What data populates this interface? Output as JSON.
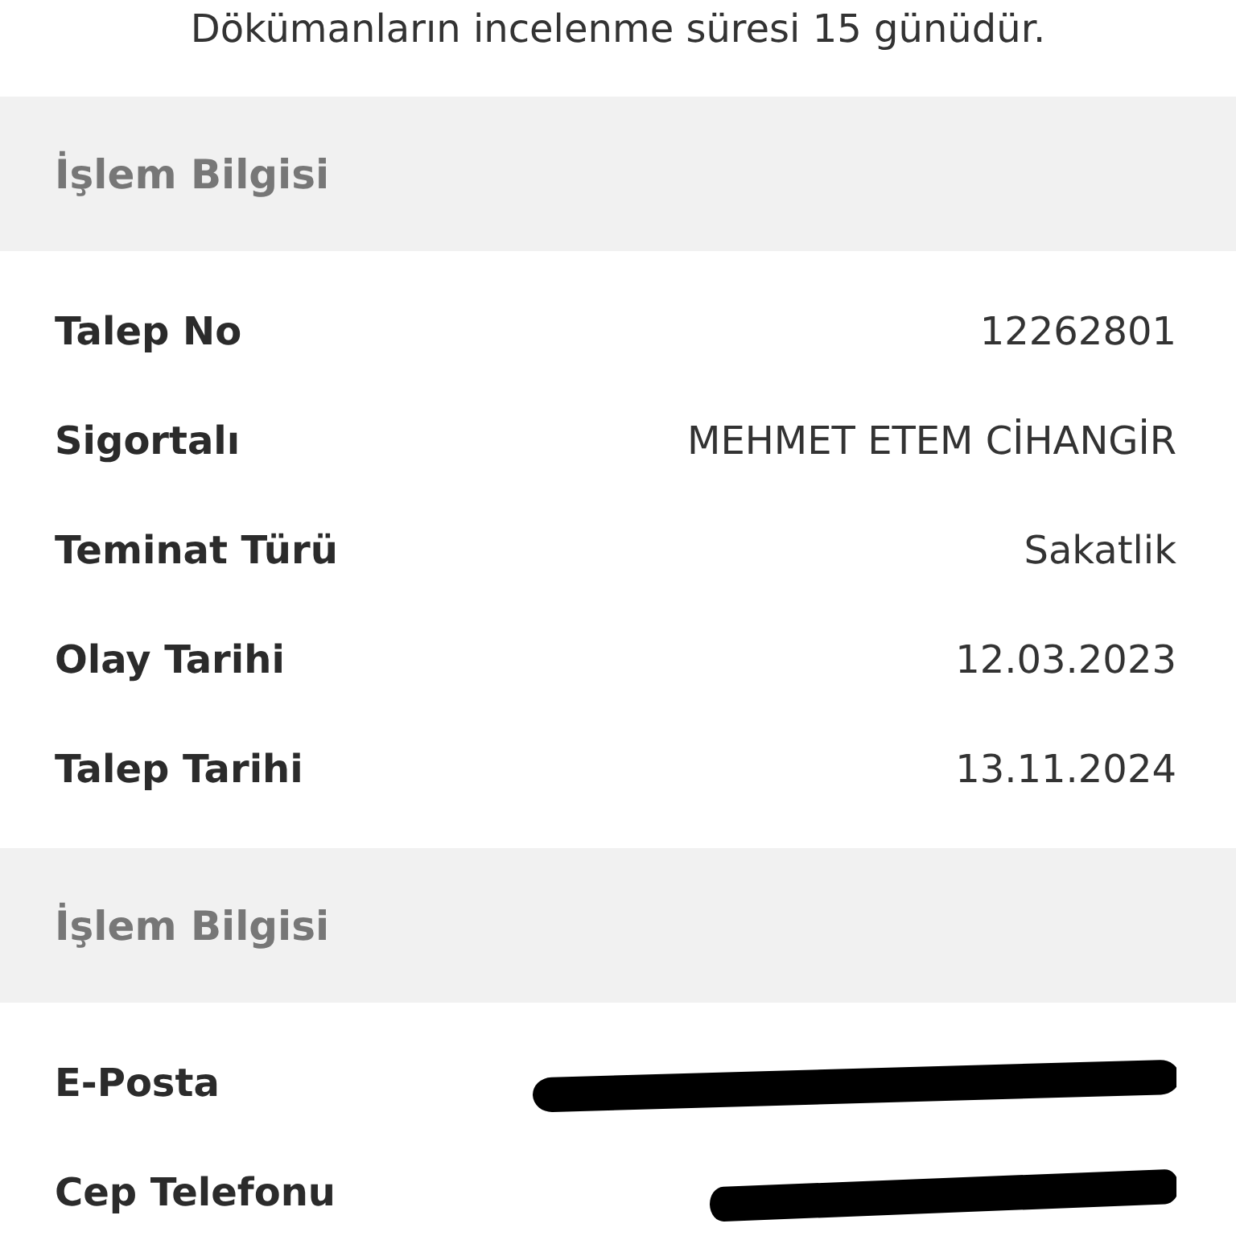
{
  "notice": "Dökümanların incelenme süresi 15 günüdür.",
  "sections": [
    {
      "title": "İşlem Bilgisi",
      "rows": [
        {
          "kind": "value",
          "label": "Talep No",
          "value": "12262801"
        },
        {
          "kind": "value",
          "label": "Sigortalı",
          "value": "MEHMET ETEM CİHANGİR"
        },
        {
          "kind": "value",
          "label": "Teminat Türü",
          "value": "Sakatlik"
        },
        {
          "kind": "value",
          "label": "Olay Tarihi",
          "value": "12.03.2023"
        },
        {
          "kind": "value",
          "label": "Talep Tarihi",
          "value": "13.11.2024"
        }
      ]
    },
    {
      "title": "İşlem Bilgisi",
      "rows": [
        {
          "kind": "redacted",
          "label": "E-Posta"
        },
        {
          "kind": "redacted",
          "label": "Cep Telefonu"
        }
      ]
    }
  ]
}
